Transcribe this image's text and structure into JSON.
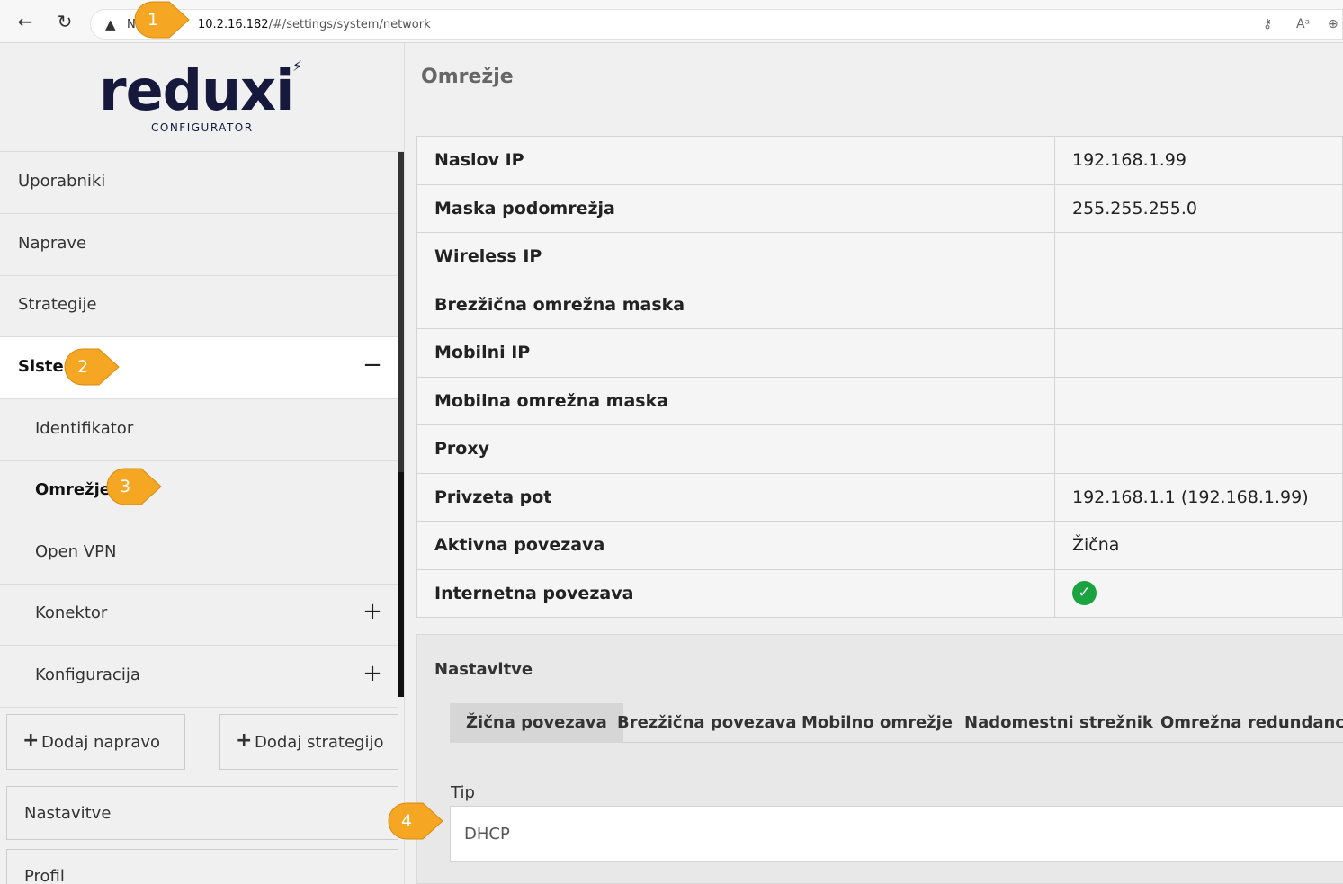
{
  "browser": {
    "not_secure": "N",
    "url_host": "10.2.16.182",
    "url_path": "/#/settings/system/network"
  },
  "logo": {
    "word": "reduxi",
    "sub": "CONFIGURATOR"
  },
  "sidebar": {
    "items": [
      {
        "label": "Uporabniki"
      },
      {
        "label": "Naprave"
      },
      {
        "label": "Strategije"
      },
      {
        "label": "Sistem",
        "toggle": "−"
      },
      {
        "label": "Identifikator"
      },
      {
        "label": "Omrežje"
      },
      {
        "label": "Open VPN"
      },
      {
        "label": "Konektor",
        "toggle": "+"
      },
      {
        "label": "Konfiguracija",
        "toggle": "+"
      }
    ],
    "add_device": "Dodaj napravo",
    "add_strategy": "Dodaj strategijo",
    "settings": "Nastavitve",
    "profile": "Profil"
  },
  "main": {
    "title": "Omrežje",
    "rows": [
      {
        "key": "Naslov IP",
        "value": "192.168.1.99"
      },
      {
        "key": "Maska podomrežja",
        "value": "255.255.255.0"
      },
      {
        "key": "Wireless IP",
        "value": ""
      },
      {
        "key": "Brezžična omrežna maska",
        "value": ""
      },
      {
        "key": "Mobilni IP",
        "value": ""
      },
      {
        "key": "Mobilna omrežna maska",
        "value": ""
      },
      {
        "key": "Proxy",
        "value": ""
      },
      {
        "key": "Privzeta pot",
        "value": "192.168.1.1 (192.168.1.99)"
      },
      {
        "key": "Aktivna povezava",
        "value": "Žična"
      },
      {
        "key": "Internetna povezava",
        "value": ""
      }
    ],
    "settings_title": "Nastavitve",
    "tabs": [
      {
        "label": "Žična povezava"
      },
      {
        "label": "Brezžična povezava"
      },
      {
        "label": "Mobilno omrežje"
      },
      {
        "label": "Nadomestni strežnik"
      },
      {
        "label": "Omrežna redundanca"
      }
    ],
    "field_label": "Tip",
    "field_value": "DHCP"
  },
  "callouts": [
    "1",
    "2",
    "3",
    "4"
  ],
  "colors": {
    "accent_callout": "#f5a623",
    "status_ok": "#1aa33f",
    "logo": "#16193b"
  }
}
